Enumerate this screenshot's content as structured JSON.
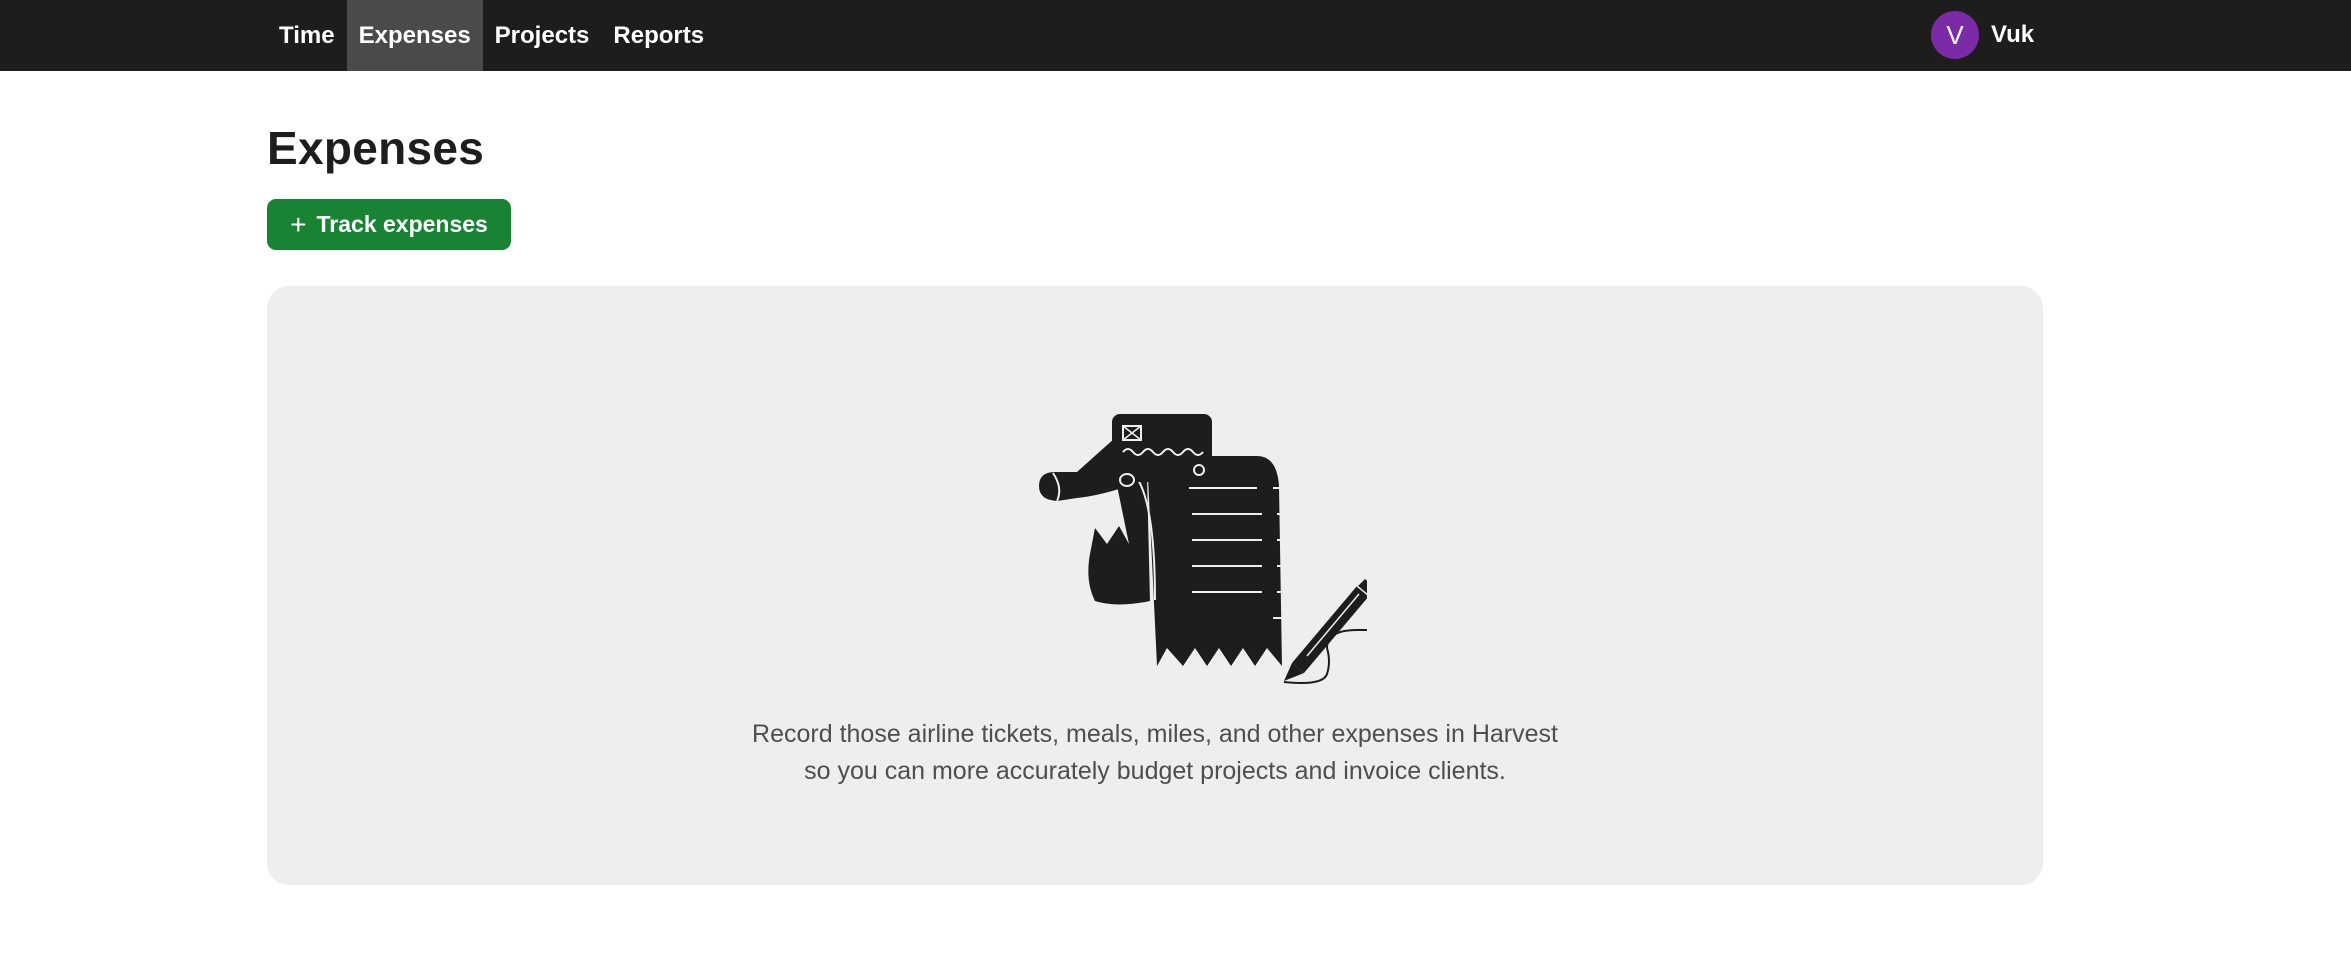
{
  "nav": {
    "items": [
      {
        "label": "Time",
        "active": false
      },
      {
        "label": "Expenses",
        "active": true
      },
      {
        "label": "Projects",
        "active": false
      },
      {
        "label": "Reports",
        "active": false
      }
    ],
    "user": {
      "initial": "V",
      "name": "Vuk",
      "avatar_color": "#7b2aa8"
    }
  },
  "page": {
    "title": "Expenses",
    "track_button_label": "Track expenses",
    "empty_state": {
      "line1": "Record those airline tickets, meals, miles, and other expenses in Harvest",
      "line2": "so you can more accurately budget projects and invoice clients."
    }
  },
  "colors": {
    "topbar": "#1d1e1c",
    "active_nav": "#4a4a48",
    "accent_green": "#188433",
    "panel_bg": "#eeeeee"
  },
  "icons": {
    "illustration": "receipt-card-pencil-illustration",
    "button": "plus-icon"
  }
}
